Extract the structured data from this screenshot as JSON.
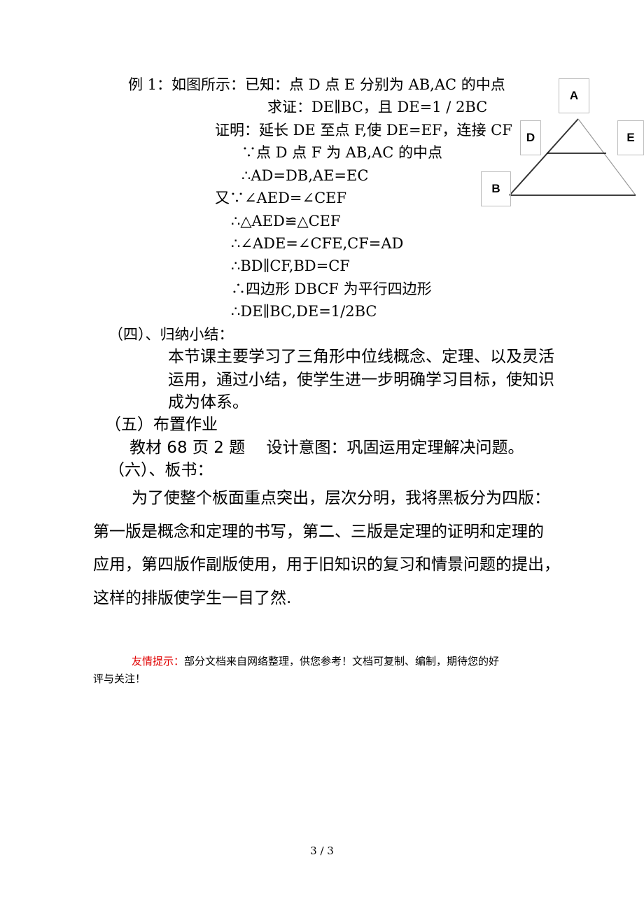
{
  "proof": [
    "例 1：如图所示：已知：点 D 点 E 分别为 AB,AC 的中点",
    "求证：DE∥BC，且 DE=1 / 2BC",
    "证明：延长 DE 至点 F,使 DE=EF，连接 CF",
    "∵点 D 点 F 为 AB,AC 的中点",
    "∴AD=DB,AE=EC",
    "又∵∠AED=∠CEF",
    "∴△AED≌△CEF",
    "∴∠ADE=∠CFE,CF=AD",
    "∴BD∥CF,BD=CF",
    "∴四边形 DBCF 为平行四边形",
    "∴DE∥BC,DE=1/2BC"
  ],
  "diagram": {
    "labels": [
      "A",
      "D",
      "E",
      "B"
    ]
  },
  "summary": {
    "heading": "（四）、归纳小结：",
    "lines": [
      "本节课主要学习了三角形中位线概念、定理、以及灵活",
      "运用，通过小结，使学生进一步明确学习目标，使知识",
      "成为体系。"
    ]
  },
  "homework": {
    "heading": "（五）布置作业",
    "text": "教材 68 页 2 题　 设计意图：巩固运用定理解决问题。"
  },
  "board": {
    "heading": "（六）、板书：",
    "lines": [
      "为了使整个板面重点突出，层次分明，我将黑板分为四版：",
      "第一版是概念和定理的书写，第二、三版是定理的证明和定理的",
      "应用，第四版作副版使用，用于旧知识的复习和情景问题的提出，",
      "这样的排版使学生一目了然."
    ]
  },
  "footer": {
    "label": "友情提示：",
    "text": "部分文档来自网络整理，供您参考！文档可复制、编制，期待您的好",
    "text2": "评与关注！",
    "label_color": "#e00000"
  },
  "page_number": "3 / 3"
}
